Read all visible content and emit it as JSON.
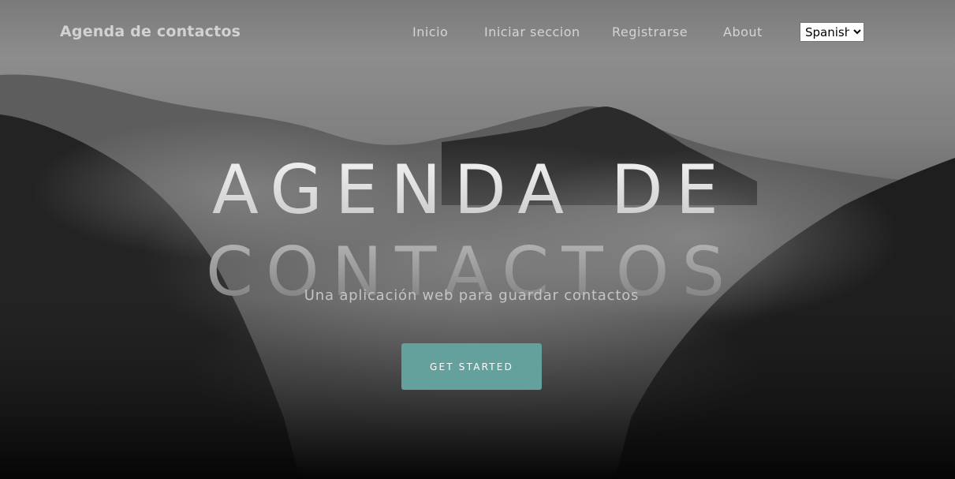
{
  "navbar": {
    "brand": "Agenda de contactos",
    "links": [
      {
        "label": "Inicio"
      },
      {
        "label": "Iniciar seccion"
      },
      {
        "label": "Registrarse"
      },
      {
        "label": "About"
      }
    ],
    "language_select": {
      "selected": "Spanish",
      "options": [
        "Spanish"
      ]
    }
  },
  "hero": {
    "title_line1": "AGENDA DE",
    "title_line2": "CONTACTOS",
    "subtitle": "Una aplicación web para guardar contactos",
    "cta_label": "GET STARTED"
  },
  "colors": {
    "accent": "#64a19d",
    "brand_text": "#d2d2d2",
    "background_top": "#8a8a8a",
    "background_bottom": "#0e0e0e"
  }
}
